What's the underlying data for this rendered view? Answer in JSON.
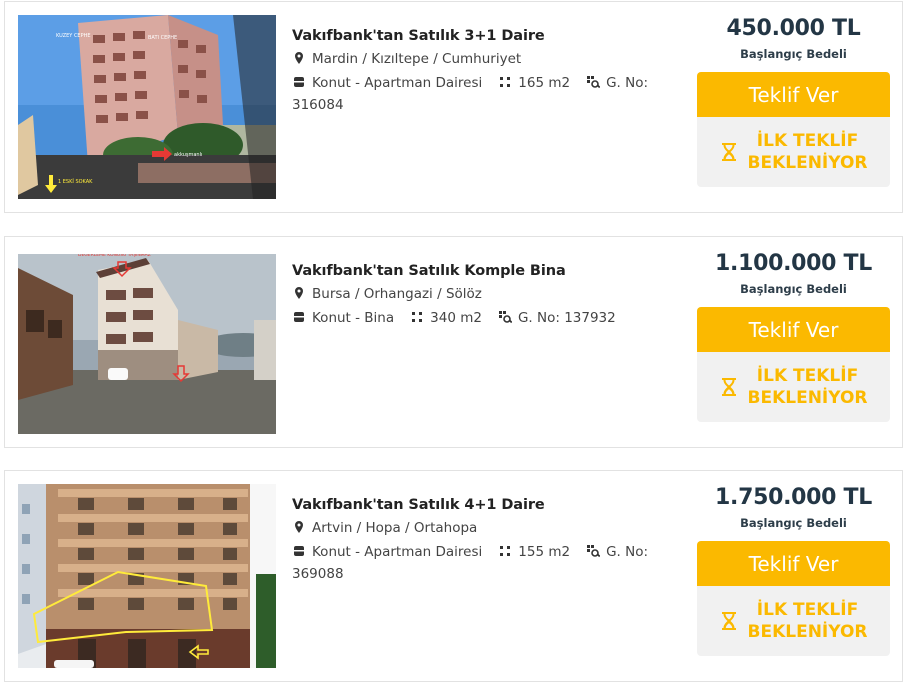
{
  "listings": [
    {
      "title": "Vakıfbank'tan Satılık 3+1 Daire",
      "location": "Mardin / Kızıltepe / Cumhuriyet",
      "type": "Konut - Apartman Dairesi",
      "area": "165 m2",
      "listing_no_a": "G. No:",
      "listing_no_b": "316084",
      "price": "450.000 TL",
      "price_label": "Başlangıç Bedeli",
      "offer_button": "Teklif Ver",
      "status_line1": "İLK TEKLİF",
      "status_line2": "BEKLENİYOR",
      "photo": {
        "sign_1": "KUZEY CEPHE",
        "sign_2": "BATI CEPHE",
        "sign_3": "akkuşmanlı",
        "sign_4": "1 ESKİ SOKAK"
      }
    },
    {
      "title": "Vakıfbank'tan Satılık Komple Bina",
      "location": "Bursa / Orhangazi / Sölöz",
      "type": "Konut - Bina",
      "area": "340 m2",
      "listing_no": "G. No: 137932",
      "price": "1.100.000 TL",
      "price_label": "Başlangıç Bedeli",
      "offer_button": "Teklif Ver",
      "status_line1": "İLK TEKLİF",
      "status_line2": "BEKLENİYOR",
      "photo": {
        "sign_1": "DEĞERLEME KONUSU TAŞINMAZ"
      }
    },
    {
      "title": "Vakıfbank'tan Satılık 4+1 Daire",
      "location": "Artvin / Hopa / Ortahopa",
      "type": "Konut - Apartman Dairesi",
      "area": "155 m2",
      "listing_no_a": "G. No:",
      "listing_no_b": "369088",
      "price": "1.750.000 TL",
      "price_label": "Başlangıç Bedeli",
      "offer_button": "Teklif Ver",
      "status_line1": "İLK TEKLİF",
      "status_line2": "BEKLENİYOR"
    }
  ],
  "colors": {
    "accent": "#fbb900",
    "price_text": "#233645",
    "status_bg": "#f1f1f1"
  },
  "icons": [
    "location-pin-icon",
    "building-icon",
    "area-dots-icon",
    "listing-number-icon",
    "hourglass-icon"
  ]
}
